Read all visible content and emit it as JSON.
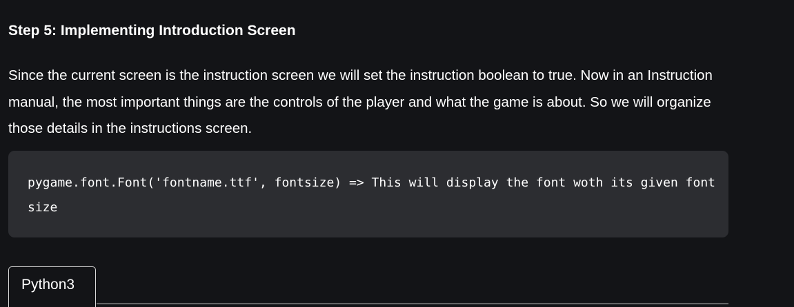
{
  "article": {
    "heading": "Step 5: Implementing Introduction Screen",
    "paragraph": "Since the current screen is the instruction screen we will set the instruction boolean to true. Now in an Instruction manual, the most important things are the controls of the player and what the game is about. So we will organize those details in the instructions screen.",
    "code": "pygame.font.Font('fontname.ttf', fontsize) => This will display the font woth its given font size"
  },
  "code_tabs": {
    "active_tab": "Python3"
  },
  "colors": {
    "page_background": "#131417",
    "code_background": "#2c2d31",
    "text": "#ffffff",
    "tab_border": "#d9d9d9"
  }
}
